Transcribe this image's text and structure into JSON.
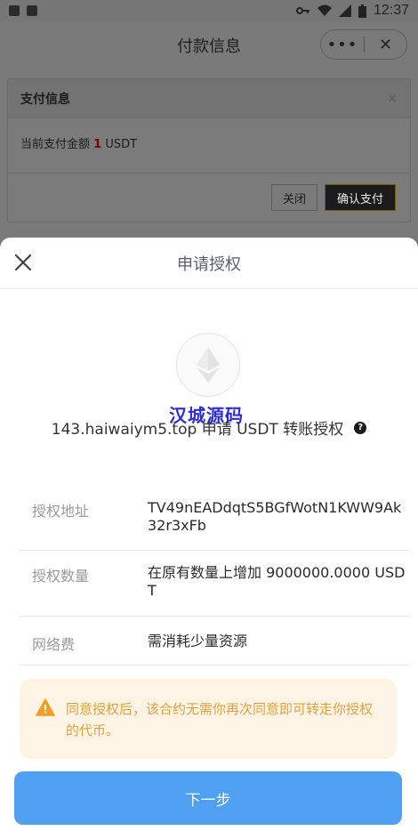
{
  "statusbar": {
    "time": "12:37"
  },
  "topbar": {
    "title": "付款信息",
    "more_icon": "•••",
    "close_icon": "✕"
  },
  "pay_dialog": {
    "title": "支付信息",
    "close_icon": "×",
    "amount_label": "当前支付金额",
    "amount_value": "1",
    "amount_unit": "USDT",
    "close_button": "关闭",
    "confirm_button": "确认支付"
  },
  "sheet": {
    "title": "申请授权",
    "watermark": "汉城源码",
    "request_text": "143.haiwaiym5.top 申请 USDT 转账授权",
    "help_icon": "?",
    "rows": [
      {
        "label": "授权地址",
        "value": "TV49nEADdqtS5BGfWotN1KWW9Ak32r3xFb"
      },
      {
        "label": "授权数量",
        "value": "在原有数量上增加 9000000.0000 USDT"
      },
      {
        "label": "网络费",
        "value": "需消耗少量资源"
      }
    ],
    "notice": "同意授权后，该合约无需你再次同意即可转走你授权的代币。",
    "next_button": "下一步"
  },
  "colors": {
    "primary": "#4f9ff2",
    "warning": "#e2a03a",
    "notice_bg": "#fdf4e6"
  }
}
